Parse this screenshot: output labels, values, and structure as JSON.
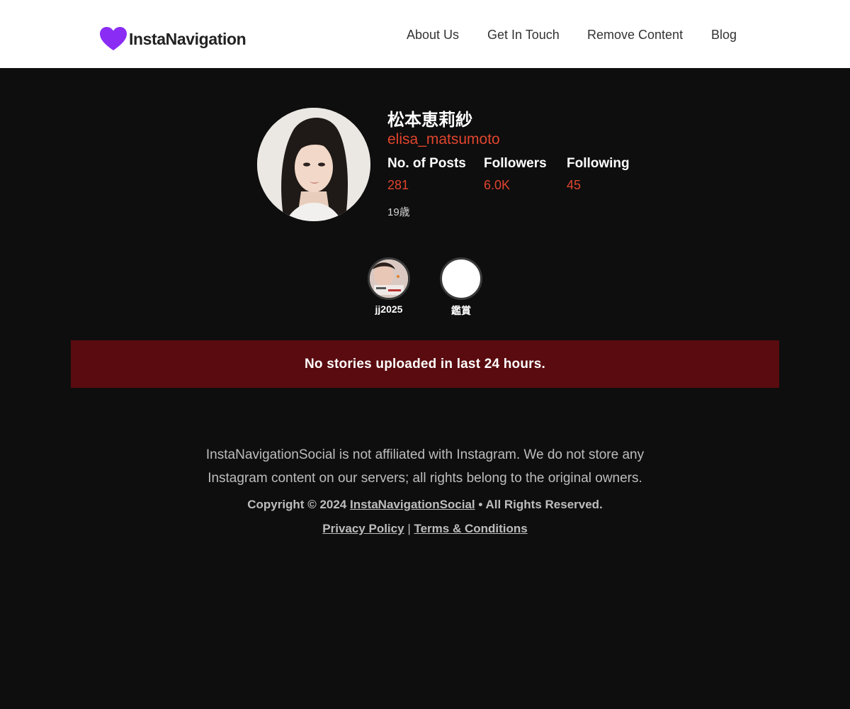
{
  "header": {
    "logo_text": "InstaNavigation",
    "nav": [
      {
        "label": "About Us"
      },
      {
        "label": "Get In Touch"
      },
      {
        "label": "Remove Content"
      },
      {
        "label": "Blog"
      }
    ]
  },
  "profile": {
    "name": "松本恵莉紗",
    "username": "elisa_matsumoto",
    "stats": [
      {
        "label": "No. of Posts",
        "value": "281"
      },
      {
        "label": "Followers",
        "value": "6.0K"
      },
      {
        "label": "Following",
        "value": "45"
      }
    ],
    "bio": "19歳"
  },
  "highlights": [
    {
      "label": "jj2025"
    },
    {
      "label": "鑑賞"
    }
  ],
  "stories_notice": "No stories uploaded in last 24 hours.",
  "footer": {
    "disclaimer_line1": "InstaNavigationSocial is not affiliated with Instagram. We do not store any",
    "disclaimer_line2": "Instagram content on our servers; all rights belong to the original owners.",
    "copyright_prefix": "Copyright © 2024",
    "copyright_link": "InstaNavigationSocial",
    "copyright_suffix": "• All Rights Reserved.",
    "privacy_label": "Privacy Policy",
    "separator": "|",
    "terms_label": "Terms & Conditions"
  },
  "colors": {
    "accent": "#e0452e",
    "logo_heart": "#8b2cf5",
    "notice_bg": "#5a0b0f",
    "page_bg": "#0e0e0e"
  },
  "icons": {
    "logo": "heart-icon"
  }
}
